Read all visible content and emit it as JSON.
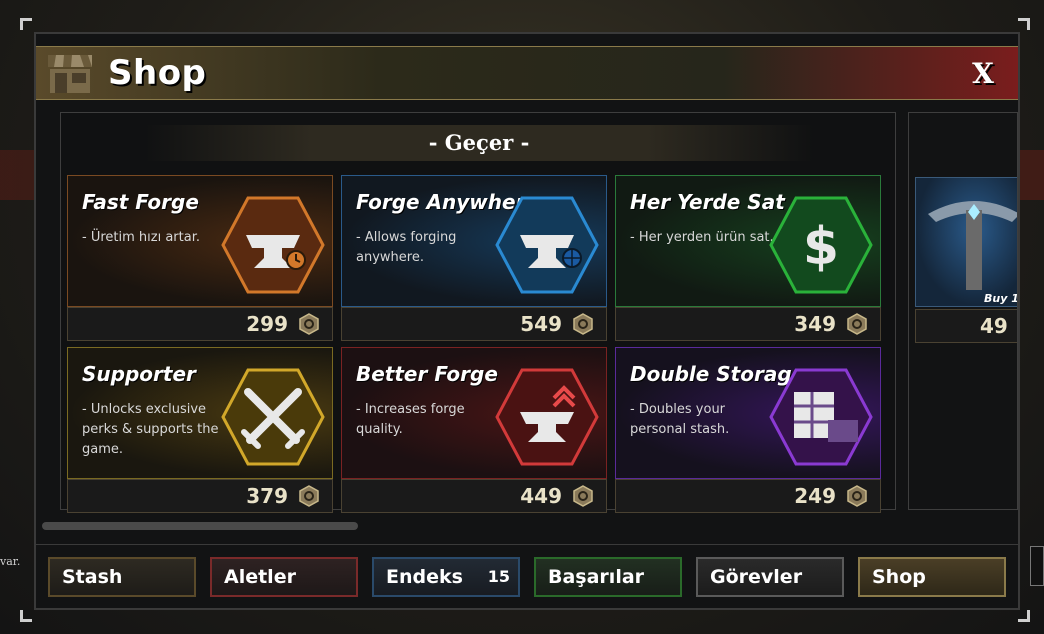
{
  "window": {
    "title": "Shop",
    "close_label": "X"
  },
  "section": {
    "title": "- Geçer -"
  },
  "cards": [
    {
      "name": "Fast Forge",
      "desc": "- Üretim hızı artar.",
      "price": "299",
      "icon": "anvil-clock-icon",
      "color": "#d2782a"
    },
    {
      "name": "Forge Anywhere",
      "desc": "- Allows forging anywhere.",
      "price": "549",
      "icon": "anvil-globe-icon",
      "color": "#2a8ad2"
    },
    {
      "name": "Her Yerde Sat",
      "desc": "- Her yerden ürün sat.",
      "price": "349",
      "icon": "dollar-icon",
      "color": "#2ab23a"
    },
    {
      "name": "Supporter",
      "desc": "- Unlocks exclusive perks & supports the game.",
      "price": "379",
      "icon": "crossed-swords-icon",
      "color": "#d2a82a"
    },
    {
      "name": "Better Forge",
      "desc": "- Increases forge quality.",
      "price": "449",
      "icon": "anvil-upgrade-icon",
      "color": "#d23a3a"
    },
    {
      "name": "Double Storage",
      "desc": "- Doubles your personal stash.",
      "price": "249",
      "icon": "storage-2x-icon",
      "color": "#8a3ad2"
    }
  ],
  "side_card": {
    "buy_label": "Buy 1",
    "price": "49",
    "icon": "pickaxe-icon"
  },
  "tabs": {
    "stash": "Stash",
    "aletler": "Aletler",
    "endeks": "Endeks",
    "endeks_count": "15",
    "basarilar": "Başarılar",
    "gorevler": "Görevler",
    "shop": "Shop"
  },
  "edge_text": "var."
}
